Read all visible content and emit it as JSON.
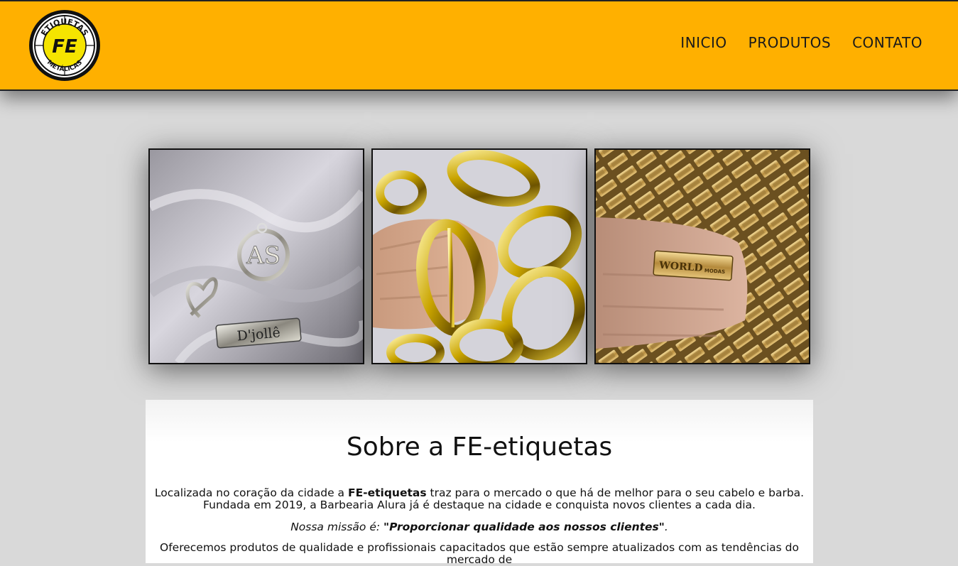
{
  "header": {
    "logo": {
      "text_top": "ETIQUETAS",
      "monogram": "FE",
      "text_bottom": "METÁLICAS"
    },
    "nav": [
      "INICIO",
      "PRODUTOS",
      "CONTATO"
    ]
  },
  "gallery": {
    "photos": [
      {
        "icon": "tag-charm-photo",
        "tag_text": "D'jollê",
        "charm_text": "AS"
      },
      {
        "icon": "gold-buckles-photo"
      },
      {
        "icon": "gold-tags-photo",
        "tag_text": "WORLD",
        "tag_text_small": "MODAS"
      }
    ]
  },
  "about": {
    "title": "Sobre a FE-etiquetas",
    "p1_before": "Localizada no coração da cidade a ",
    "p1_bold": "FE-etiquetas",
    "p1_after": " traz para o mercado o que há de melhor para o seu cabelo e barba. Fundada em 2019, a Barbearia Alura já é destaque na cidade e conquista novos clientes a cada dia.",
    "mission_label": "Nossa missão é: ",
    "mission_text": "\"Proporcionar qualidade aos nossos clientes\"",
    "mission_end": ".",
    "p3": "Oferecemos produtos de qualidade e profissionais capacitados que estão sempre atualizados com as tendências do mercado de"
  },
  "colors": {
    "header": "#ffb000",
    "background": "#d9d9d9"
  }
}
